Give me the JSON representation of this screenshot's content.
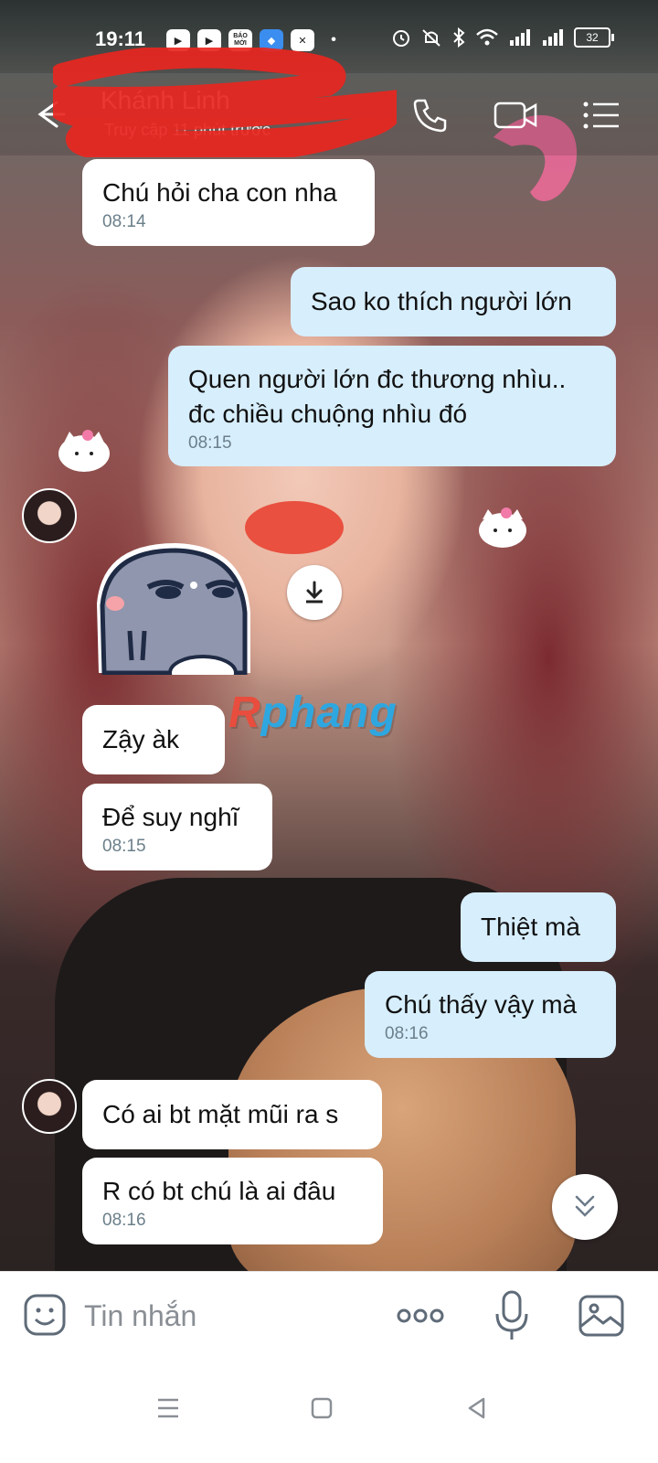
{
  "status_bar": {
    "time": "19:11",
    "apps": [
      "▶",
      "▶",
      "BÁO MỚI",
      "◆",
      "✕"
    ],
    "battery": "32"
  },
  "header": {
    "contact_name": "Khánh Linh",
    "contact_status": "Truy cập 11 phút trước"
  },
  "messages": [
    {
      "side": "in",
      "text": "Chú hỏi cha con nha",
      "time": "08:14"
    },
    {
      "side": "out",
      "text": "Sao ko thích người lớn",
      "time": ""
    },
    {
      "side": "out",
      "text": "Quen người lớn đc thương nhìu..\nđc chiều chuộng nhìu đó",
      "time": "08:15"
    },
    {
      "side": "in",
      "text": "Zậy àk",
      "time": ""
    },
    {
      "side": "in",
      "text": "Để suy nghĩ",
      "time": "08:15"
    },
    {
      "side": "out",
      "text": "Thiệt mà",
      "time": ""
    },
    {
      "side": "out",
      "text": "Chú thấy vậy mà",
      "time": "08:16"
    },
    {
      "side": "in",
      "text": "Có ai bt mặt mũi ra s",
      "time": ""
    },
    {
      "side": "in",
      "text": "R có bt chú là ai đâu",
      "time": "08:16"
    }
  ],
  "watermark": {
    "first": "R",
    "rest": "phang"
  },
  "input": {
    "placeholder": "Tin nhắn"
  },
  "colors": {
    "incoming_bubble": "#ffffff",
    "outgoing_bubble": "#d7eefd",
    "accent": "#2ea7e0"
  }
}
